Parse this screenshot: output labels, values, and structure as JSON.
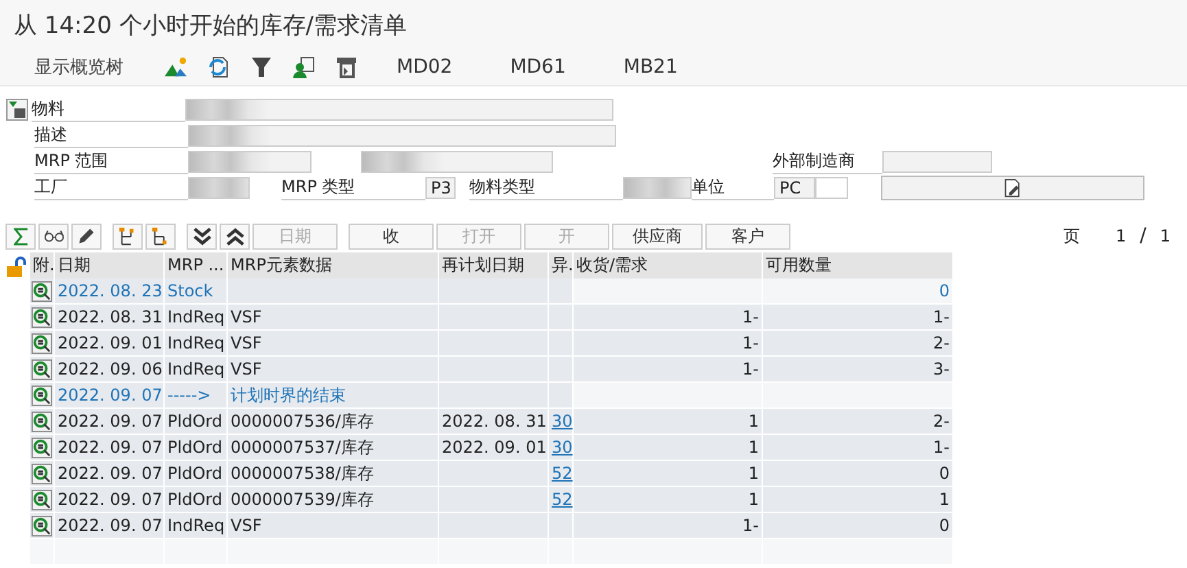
{
  "title": "从 14:20 个小时开始的库存/需求清单",
  "toolbar": {
    "overview_button": "显示概览树",
    "transactions": [
      "MD02",
      "MD61",
      "MB21"
    ]
  },
  "header": {
    "material": {
      "label": "物料",
      "masked": true
    },
    "description": {
      "label": "描述",
      "masked": true
    },
    "mrp_area": {
      "label": "MRP 范围",
      "masked": true
    },
    "manufacturer": {
      "label": "外部制造商"
    },
    "plant": {
      "label": "工厂",
      "masked": true
    },
    "mrp_type": {
      "label": "MRP 类型",
      "value": "P3"
    },
    "material_type": {
      "label": "物料类型",
      "masked": true
    },
    "unit": {
      "label": "单位",
      "value": "PC"
    }
  },
  "actions": [
    {
      "label": "日期",
      "disabled": true
    },
    {
      "label": "收",
      "disabled": false
    },
    {
      "label": "打开",
      "disabled": true
    },
    {
      "label": "开",
      "disabled": true
    },
    {
      "label": "供应商",
      "disabled": false
    },
    {
      "label": "客户",
      "disabled": false
    }
  ],
  "page": {
    "label": "页",
    "current": "1",
    "separator": "/",
    "total": "1"
  },
  "table": {
    "columns": [
      "附.",
      "日期",
      "MRP ...",
      "MRP元素数据",
      "再计划日期",
      "异.",
      "收货/需求",
      "可用数量"
    ],
    "rows": [
      {
        "kind": "marker",
        "date": "2022. 08. 23",
        "element": "Stock",
        "available": "0"
      },
      {
        "kind": "item",
        "date": "2022. 08. 31",
        "element": "IndReq",
        "data": "VSF",
        "receipt": "1-",
        "available": "1-"
      },
      {
        "kind": "item",
        "date": "2022. 09. 01",
        "element": "IndReq",
        "data": "VSF",
        "receipt": "1-",
        "available": "2-"
      },
      {
        "kind": "item",
        "date": "2022. 09. 06",
        "element": "IndReq",
        "data": "VSF",
        "receipt": "1-",
        "available": "3-"
      },
      {
        "kind": "marker",
        "date": "2022. 09. 07",
        "element": "----->",
        "data": "计划时界的结束"
      },
      {
        "kind": "item",
        "date": "2022. 09. 07",
        "element": "PldOrd",
        "data": "0000007536/库存",
        "reschedule": "2022. 08. 31",
        "exception": "30",
        "receipt": "1",
        "available": "2-"
      },
      {
        "kind": "item",
        "date": "2022. 09. 07",
        "element": "PldOrd",
        "data": "0000007537/库存",
        "reschedule": "2022. 09. 01",
        "exception": "30",
        "receipt": "1",
        "available": "1-"
      },
      {
        "kind": "item",
        "date": "2022. 09. 07",
        "element": "PldOrd",
        "data": "0000007538/库存",
        "exception": "52",
        "receipt": "1",
        "available": "0"
      },
      {
        "kind": "item",
        "date": "2022. 09. 07",
        "element": "PldOrd",
        "data": "0000007539/库存",
        "exception": "52",
        "receipt": "1",
        "available": "1"
      },
      {
        "kind": "item",
        "date": "2022. 09. 07",
        "element": "IndReq",
        "data": "VSF",
        "receipt": "1-",
        "available": "0"
      }
    ]
  }
}
